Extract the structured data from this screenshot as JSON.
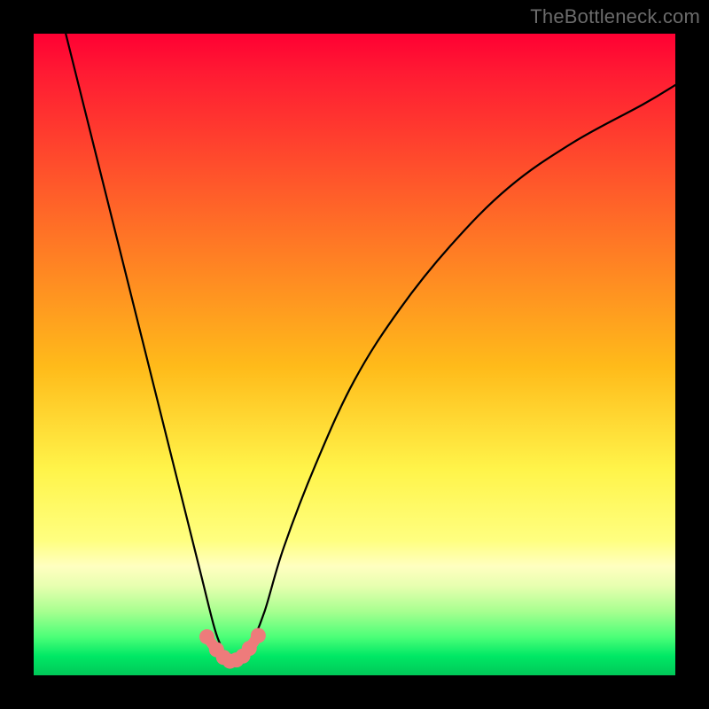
{
  "watermark": "TheBottleneck.com",
  "colors": {
    "page_bg": "#000000",
    "gradient_top": "#ff0033",
    "gradient_mid_orange": "#ff8a1a",
    "gradient_yellow": "#ffff60",
    "gradient_bottom": "#00c858",
    "curve_stroke": "#000000",
    "marker_fill": "#ee7b7b",
    "marker_stroke": "#c84e4e"
  },
  "chart_data": {
    "type": "line",
    "title": "",
    "xlabel": "",
    "ylabel": "",
    "xlim": [
      0,
      100
    ],
    "ylim": [
      0,
      100
    ],
    "grid": false,
    "legend": false,
    "series": [
      {
        "name": "bottleneck-curve",
        "x": [
          5,
          8,
          11,
          14,
          17,
          20,
          23,
          26,
          28,
          29,
          30,
          31,
          32,
          33,
          34,
          36,
          39,
          44,
          50,
          57,
          65,
          74,
          84,
          95,
          100
        ],
        "y": [
          100,
          88,
          76,
          64,
          52,
          40,
          28,
          16,
          8,
          5,
          3,
          2,
          2,
          3,
          5,
          10,
          20,
          33,
          46,
          57,
          67,
          76,
          83,
          89,
          92
        ]
      }
    ],
    "markers": {
      "name": "highlight-points",
      "x": [
        27.0,
        28.5,
        29.6,
        30.6,
        31.6,
        32.6,
        33.6,
        35.0
      ],
      "y": [
        6.0,
        4.0,
        2.8,
        2.2,
        2.4,
        3.0,
        4.2,
        6.2
      ]
    }
  }
}
